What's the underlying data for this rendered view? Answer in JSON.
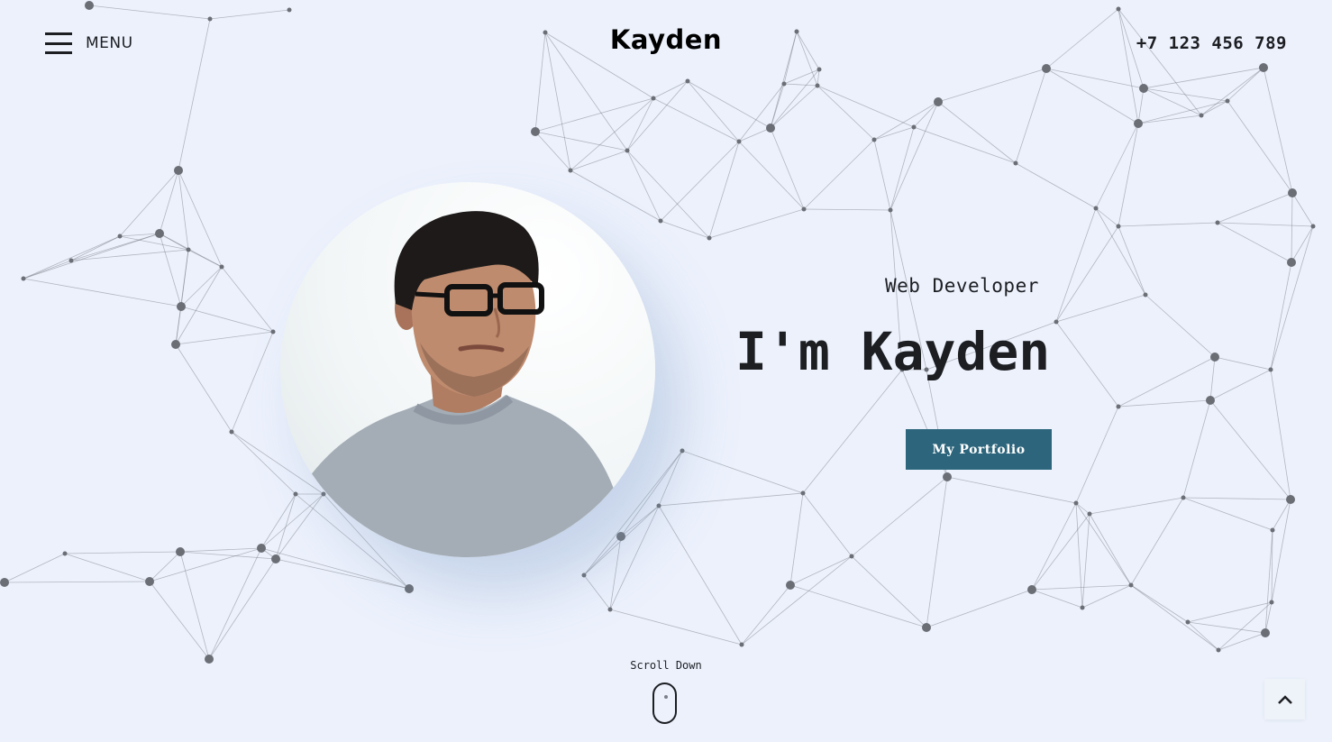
{
  "header": {
    "menu_label": "MENU",
    "logo": "Kayden",
    "phone": "+7 123 456 789"
  },
  "hero": {
    "subtitle": "Web Developer",
    "headline": "I'm Kayden",
    "cta_label": "My Portfolio"
  },
  "scroll": {
    "label": "Scroll Down"
  },
  "icons": {
    "menu": "hamburger-icon",
    "scroll": "mouse-icon",
    "back_to_top": "chevron-up-icon"
  },
  "colors": {
    "background": "#ecf1fc",
    "accent": "#2c657c",
    "text": "#1c1e22",
    "network_nodes": "#6b6e75"
  }
}
